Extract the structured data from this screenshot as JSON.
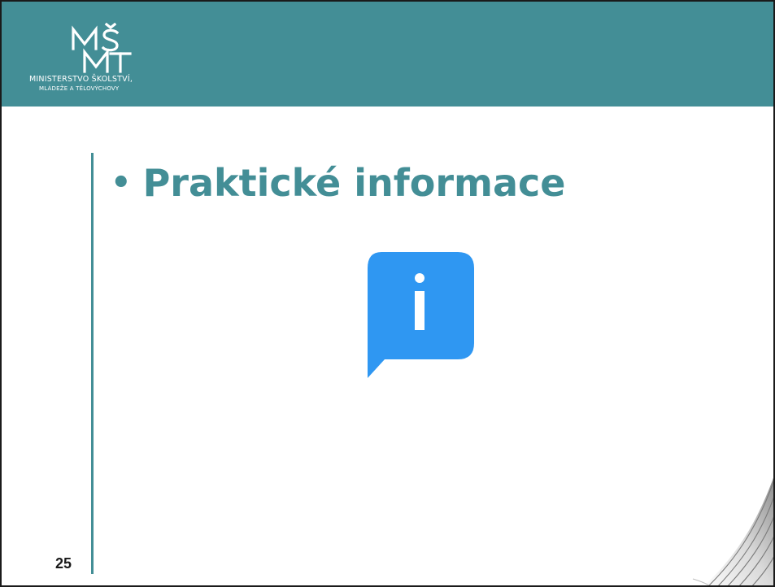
{
  "slide": {
    "logo": {
      "mark_icon": "msmt-logo-mark",
      "line1": "MINISTERSTVO ŠKOLSTVÍ,",
      "line2": "MLÁDEŽE A TĚLOVÝCHOVY"
    },
    "bullet": "•",
    "title": "Praktické informace",
    "icon": "info-speech-bubble-icon",
    "page_number": "25"
  },
  "colors": {
    "header": "#438e96",
    "title": "#438e96",
    "accent_line": "#438e96",
    "icon_blue": "#2f97f2"
  }
}
